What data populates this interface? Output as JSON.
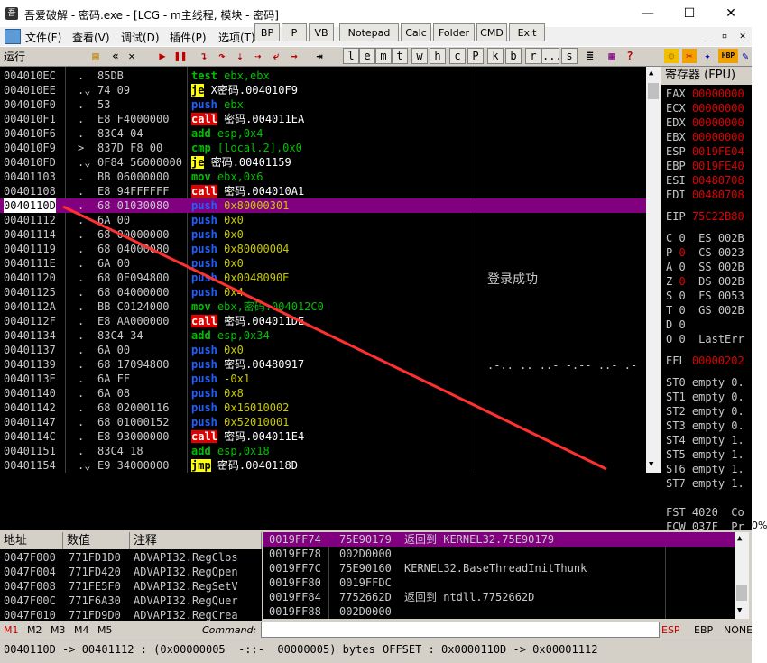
{
  "window": {
    "title": "吾爱破解 - 密码.exe - [LCG - m主线程, 模块 - 密码]",
    "minimize": "—",
    "maximize": "☐",
    "close": "✕"
  },
  "menu": [
    "文件(F)",
    "查看(V)",
    "调试(D)",
    "插件(P)",
    "选项(T)"
  ],
  "plugins": [
    "BP",
    "P",
    "VB",
    "Notepad",
    "Calc",
    "Folder",
    "CMD",
    "Exit"
  ],
  "toolbar": {
    "status": "运行",
    "letters": [
      "l",
      "e",
      "m",
      "t",
      "w",
      "h",
      "c",
      "P",
      "k",
      "b",
      "r",
      "...",
      "s"
    ]
  },
  "disasm": [
    {
      "addr": "004010EC",
      "mark": ".",
      "hex": "85DB",
      "mn": "test",
      "ops": "ebx,ebx",
      "kind": "test"
    },
    {
      "addr": "004010EE",
      "mark": ".⌄",
      "hex": "74 09",
      "mn": "je",
      "ops": "X密码.004010F9",
      "kind": "jcc"
    },
    {
      "addr": "004010F0",
      "mark": ".",
      "hex": "53",
      "mn": "push",
      "ops": "ebx",
      "kind": "push"
    },
    {
      "addr": "004010F1",
      "mark": ".",
      "hex": "E8 F4000000",
      "mn": "call",
      "ops": "密码.004011EA",
      "kind": "call"
    },
    {
      "addr": "004010F6",
      "mark": ".",
      "hex": "83C4 04",
      "mn": "add",
      "ops": "esp,0x4",
      "kind": "add"
    },
    {
      "addr": "004010F9",
      "mark": ">",
      "hex": "837D F8 00",
      "mn": "cmp",
      "ops": "[local.2],0x0",
      "kind": "cmp"
    },
    {
      "addr": "004010FD",
      "mark": ".⌄",
      "hex": "0F84 56000000",
      "mn": "je",
      "ops": "密码.00401159",
      "kind": "jcc"
    },
    {
      "addr": "00401103",
      "mark": ".",
      "hex": "BB 06000000",
      "mn": "mov",
      "ops": "ebx,0x6",
      "kind": "mov"
    },
    {
      "addr": "00401108",
      "mark": ".",
      "hex": "E8 94FFFFFF",
      "mn": "call",
      "ops": "密码.004010A1",
      "kind": "call"
    },
    {
      "addr": "0040110D",
      "mark": ".",
      "hex": "68 01030080",
      "mn": "push",
      "ops": "0x80000301",
      "kind": "push",
      "selected": true
    },
    {
      "addr": "00401112",
      "mark": ".",
      "hex": "6A 00",
      "mn": "push",
      "ops": "0x0",
      "kind": "push"
    },
    {
      "addr": "00401114",
      "mark": ".",
      "hex": "68 00000000",
      "mn": "push",
      "ops": "0x0",
      "kind": "push"
    },
    {
      "addr": "00401119",
      "mark": ".",
      "hex": "68 04000080",
      "mn": "push",
      "ops": "0x80000004",
      "kind": "push"
    },
    {
      "addr": "0040111E",
      "mark": ".",
      "hex": "6A 00",
      "mn": "push",
      "ops": "0x0",
      "kind": "push"
    },
    {
      "addr": "00401120",
      "mark": ".",
      "hex": "68 0E094800",
      "mn": "push",
      "ops": "0x0048090E",
      "kind": "push"
    },
    {
      "addr": "00401125",
      "mark": ".",
      "hex": "68 04000000",
      "mn": "push",
      "ops": "0x4",
      "kind": "push"
    },
    {
      "addr": "0040112A",
      "mark": ".",
      "hex": "BB C0124000",
      "mn": "mov",
      "ops": "ebx,密码.004012C0",
      "kind": "mov"
    },
    {
      "addr": "0040112F",
      "mark": ".",
      "hex": "E8 AA000000",
      "mn": "call",
      "ops": "密码.004011DE",
      "kind": "call"
    },
    {
      "addr": "00401134",
      "mark": ".",
      "hex": "83C4 34",
      "mn": "add",
      "ops": "esp,0x34",
      "kind": "add"
    },
    {
      "addr": "00401137",
      "mark": ".",
      "hex": "6A 00",
      "mn": "push",
      "ops": "0x0",
      "kind": "push"
    },
    {
      "addr": "00401139",
      "mark": ".",
      "hex": "68 17094800",
      "mn": "push",
      "ops": "密码.00480917",
      "kind": "push"
    },
    {
      "addr": "0040113E",
      "mark": ".",
      "hex": "6A FF",
      "mn": "push",
      "ops": "-0x1",
      "kind": "push"
    },
    {
      "addr": "00401140",
      "mark": ".",
      "hex": "6A 08",
      "mn": "push",
      "ops": "0x8",
      "kind": "push"
    },
    {
      "addr": "00401142",
      "mark": ".",
      "hex": "68 02000116",
      "mn": "push",
      "ops": "0x16010002",
      "kind": "push"
    },
    {
      "addr": "00401147",
      "mark": ".",
      "hex": "68 01000152",
      "mn": "push",
      "ops": "0x52010001",
      "kind": "push"
    },
    {
      "addr": "0040114C",
      "mark": ".",
      "hex": "E8 93000000",
      "mn": "call",
      "ops": "密码.004011E4",
      "kind": "call"
    },
    {
      "addr": "00401151",
      "mark": ".",
      "hex": "83C4 18",
      "mn": "add",
      "ops": "esp,0x18",
      "kind": "add"
    },
    {
      "addr": "00401154",
      "mark": ".⌄",
      "hex": "E9 34000000",
      "mn": "jmp",
      "ops": "密码.0040118D",
      "kind": "jmp"
    }
  ],
  "overlay": {
    "success": "登录成功",
    "dashes": ".-.. .. ..- -.-- ..- .- ."
  },
  "registers": {
    "header": "寄存器 (FPU)",
    "gp": [
      {
        "name": "EAX",
        "val": "00000000"
      },
      {
        "name": "ECX",
        "val": "00000000"
      },
      {
        "name": "EDX",
        "val": "00000000"
      },
      {
        "name": "EBX",
        "val": "00000000"
      },
      {
        "name": "ESP",
        "val": "0019FE04"
      },
      {
        "name": "EBP",
        "val": "0019FE40"
      },
      {
        "name": "ESI",
        "val": "00480708"
      },
      {
        "name": "EDI",
        "val": "00480708"
      }
    ],
    "eip": {
      "name": "EIP",
      "val": "75C22B80"
    },
    "flags": [
      {
        "f": "C",
        "v": "0",
        "seg": "ES 002B"
      },
      {
        "f": "P",
        "v": "0",
        "seg": "CS 0023"
      },
      {
        "f": "A",
        "v": "0",
        "seg": "SS 002B"
      },
      {
        "f": "Z",
        "v": "0",
        "seg": "DS 002B"
      },
      {
        "f": "S",
        "v": "0",
        "seg": "FS 0053"
      },
      {
        "f": "T",
        "v": "0",
        "seg": "GS 002B"
      },
      {
        "f": "D",
        "v": "0",
        "seg": ""
      },
      {
        "f": "O",
        "v": "0",
        "seg": "LastErr"
      }
    ],
    "efl": {
      "name": "EFL",
      "val": "00000202"
    },
    "fpu": [
      {
        "name": "ST0",
        "val": "empty 0."
      },
      {
        "name": "ST1",
        "val": "empty 0."
      },
      {
        "name": "ST2",
        "val": "empty 0."
      },
      {
        "name": "ST3",
        "val": "empty 0."
      },
      {
        "name": "ST4",
        "val": "empty 1."
      },
      {
        "name": "ST5",
        "val": "empty 1."
      },
      {
        "name": "ST6",
        "val": "empty 1."
      },
      {
        "name": "ST7",
        "val": "empty 1."
      }
    ],
    "fst": "FST 4020  Co",
    "fcw": "FCW 037F  Pr"
  },
  "dump": {
    "headers": [
      "地址",
      "数值",
      "注释"
    ],
    "rows": [
      {
        "addr": "0047F000",
        "val": "771FD1D0",
        "cmt": "ADVAPI32.RegClos"
      },
      {
        "addr": "0047F004",
        "val": "771FD420",
        "cmt": "ADVAPI32.RegOpen"
      },
      {
        "addr": "0047F008",
        "val": "771FE5F0",
        "cmt": "ADVAPI32.RegSetV"
      },
      {
        "addr": "0047F00C",
        "val": "771F6A30",
        "cmt": "ADVAPI32.RegQuer"
      },
      {
        "addr": "0047F010",
        "val": "771FD9D0",
        "cmt": "ADVAPI32.RegCrea"
      }
    ]
  },
  "stack": [
    {
      "addr": "0019FF74",
      "val": "75E90179",
      "cmt": "返回到 KERNEL32.75E90179",
      "selected": true
    },
    {
      "addr": "0019FF78",
      "val": "002D0000",
      "cmt": ""
    },
    {
      "addr": "0019FF7C",
      "val": "75E90160",
      "cmt": "KERNEL32.BaseThreadInitThunk"
    },
    {
      "addr": "0019FF80",
      "val": "0019FFDC",
      "cmt": ""
    },
    {
      "addr": "0019FF84",
      "val": "7752662D",
      "cmt": "返回到 ntdll.7752662D"
    },
    {
      "addr": "0019FF88",
      "val": "002D0000",
      "cmt": ""
    }
  ],
  "cmdbar": {
    "tabs": [
      "M1",
      "M2",
      "M3",
      "M4",
      "M5"
    ],
    "label": "Command:",
    "right": [
      "ESP",
      "EBP",
      "NONE"
    ]
  },
  "statusbar": {
    "left": "0040110D -> 00401112 : (0x00000005  -::-  00000005) bytes",
    "right": "OFFSET : 0x0000110D -> 0x00001112"
  },
  "side_percent": "0%",
  "colors": {
    "accent": "#800080",
    "arrow": "#ff3030"
  }
}
